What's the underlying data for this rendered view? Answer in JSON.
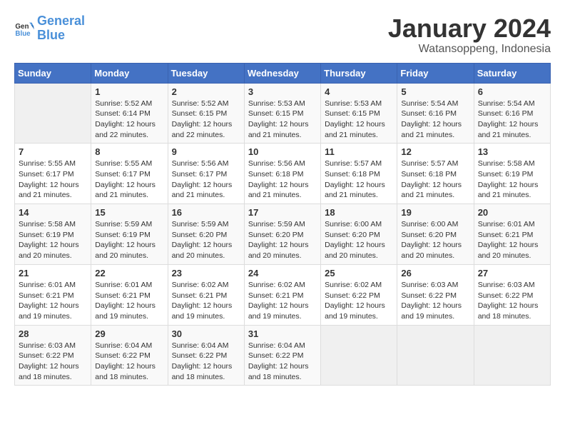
{
  "logo": {
    "text_general": "General",
    "text_blue": "Blue"
  },
  "header": {
    "title": "January 2024",
    "subtitle": "Watansoppeng, Indonesia"
  },
  "weekdays": [
    "Sunday",
    "Monday",
    "Tuesday",
    "Wednesday",
    "Thursday",
    "Friday",
    "Saturday"
  ],
  "weeks": [
    [
      {
        "day": "",
        "empty": true
      },
      {
        "day": "1",
        "sunrise": "5:52 AM",
        "sunset": "6:14 PM",
        "daylight": "12 hours and 22 minutes."
      },
      {
        "day": "2",
        "sunrise": "5:52 AM",
        "sunset": "6:15 PM",
        "daylight": "12 hours and 22 minutes."
      },
      {
        "day": "3",
        "sunrise": "5:53 AM",
        "sunset": "6:15 PM",
        "daylight": "12 hours and 21 minutes."
      },
      {
        "day": "4",
        "sunrise": "5:53 AM",
        "sunset": "6:15 PM",
        "daylight": "12 hours and 21 minutes."
      },
      {
        "day": "5",
        "sunrise": "5:54 AM",
        "sunset": "6:16 PM",
        "daylight": "12 hours and 21 minutes."
      },
      {
        "day": "6",
        "sunrise": "5:54 AM",
        "sunset": "6:16 PM",
        "daylight": "12 hours and 21 minutes."
      }
    ],
    [
      {
        "day": "7",
        "sunrise": "5:55 AM",
        "sunset": "6:17 PM",
        "daylight": "12 hours and 21 minutes."
      },
      {
        "day": "8",
        "sunrise": "5:55 AM",
        "sunset": "6:17 PM",
        "daylight": "12 hours and 21 minutes."
      },
      {
        "day": "9",
        "sunrise": "5:56 AM",
        "sunset": "6:17 PM",
        "daylight": "12 hours and 21 minutes."
      },
      {
        "day": "10",
        "sunrise": "5:56 AM",
        "sunset": "6:18 PM",
        "daylight": "12 hours and 21 minutes."
      },
      {
        "day": "11",
        "sunrise": "5:57 AM",
        "sunset": "6:18 PM",
        "daylight": "12 hours and 21 minutes."
      },
      {
        "day": "12",
        "sunrise": "5:57 AM",
        "sunset": "6:18 PM",
        "daylight": "12 hours and 21 minutes."
      },
      {
        "day": "13",
        "sunrise": "5:58 AM",
        "sunset": "6:19 PM",
        "daylight": "12 hours and 21 minutes."
      }
    ],
    [
      {
        "day": "14",
        "sunrise": "5:58 AM",
        "sunset": "6:19 PM",
        "daylight": "12 hours and 20 minutes."
      },
      {
        "day": "15",
        "sunrise": "5:59 AM",
        "sunset": "6:19 PM",
        "daylight": "12 hours and 20 minutes."
      },
      {
        "day": "16",
        "sunrise": "5:59 AM",
        "sunset": "6:20 PM",
        "daylight": "12 hours and 20 minutes."
      },
      {
        "day": "17",
        "sunrise": "5:59 AM",
        "sunset": "6:20 PM",
        "daylight": "12 hours and 20 minutes."
      },
      {
        "day": "18",
        "sunrise": "6:00 AM",
        "sunset": "6:20 PM",
        "daylight": "12 hours and 20 minutes."
      },
      {
        "day": "19",
        "sunrise": "6:00 AM",
        "sunset": "6:20 PM",
        "daylight": "12 hours and 20 minutes."
      },
      {
        "day": "20",
        "sunrise": "6:01 AM",
        "sunset": "6:21 PM",
        "daylight": "12 hours and 20 minutes."
      }
    ],
    [
      {
        "day": "21",
        "sunrise": "6:01 AM",
        "sunset": "6:21 PM",
        "daylight": "12 hours and 19 minutes."
      },
      {
        "day": "22",
        "sunrise": "6:01 AM",
        "sunset": "6:21 PM",
        "daylight": "12 hours and 19 minutes."
      },
      {
        "day": "23",
        "sunrise": "6:02 AM",
        "sunset": "6:21 PM",
        "daylight": "12 hours and 19 minutes."
      },
      {
        "day": "24",
        "sunrise": "6:02 AM",
        "sunset": "6:21 PM",
        "daylight": "12 hours and 19 minutes."
      },
      {
        "day": "25",
        "sunrise": "6:02 AM",
        "sunset": "6:22 PM",
        "daylight": "12 hours and 19 minutes."
      },
      {
        "day": "26",
        "sunrise": "6:03 AM",
        "sunset": "6:22 PM",
        "daylight": "12 hours and 19 minutes."
      },
      {
        "day": "27",
        "sunrise": "6:03 AM",
        "sunset": "6:22 PM",
        "daylight": "12 hours and 18 minutes."
      }
    ],
    [
      {
        "day": "28",
        "sunrise": "6:03 AM",
        "sunset": "6:22 PM",
        "daylight": "12 hours and 18 minutes."
      },
      {
        "day": "29",
        "sunrise": "6:04 AM",
        "sunset": "6:22 PM",
        "daylight": "12 hours and 18 minutes."
      },
      {
        "day": "30",
        "sunrise": "6:04 AM",
        "sunset": "6:22 PM",
        "daylight": "12 hours and 18 minutes."
      },
      {
        "day": "31",
        "sunrise": "6:04 AM",
        "sunset": "6:22 PM",
        "daylight": "12 hours and 18 minutes."
      },
      {
        "day": "",
        "empty": true
      },
      {
        "day": "",
        "empty": true
      },
      {
        "day": "",
        "empty": true
      }
    ]
  ],
  "labels": {
    "sunrise": "Sunrise:",
    "sunset": "Sunset:",
    "daylight": "Daylight:"
  }
}
